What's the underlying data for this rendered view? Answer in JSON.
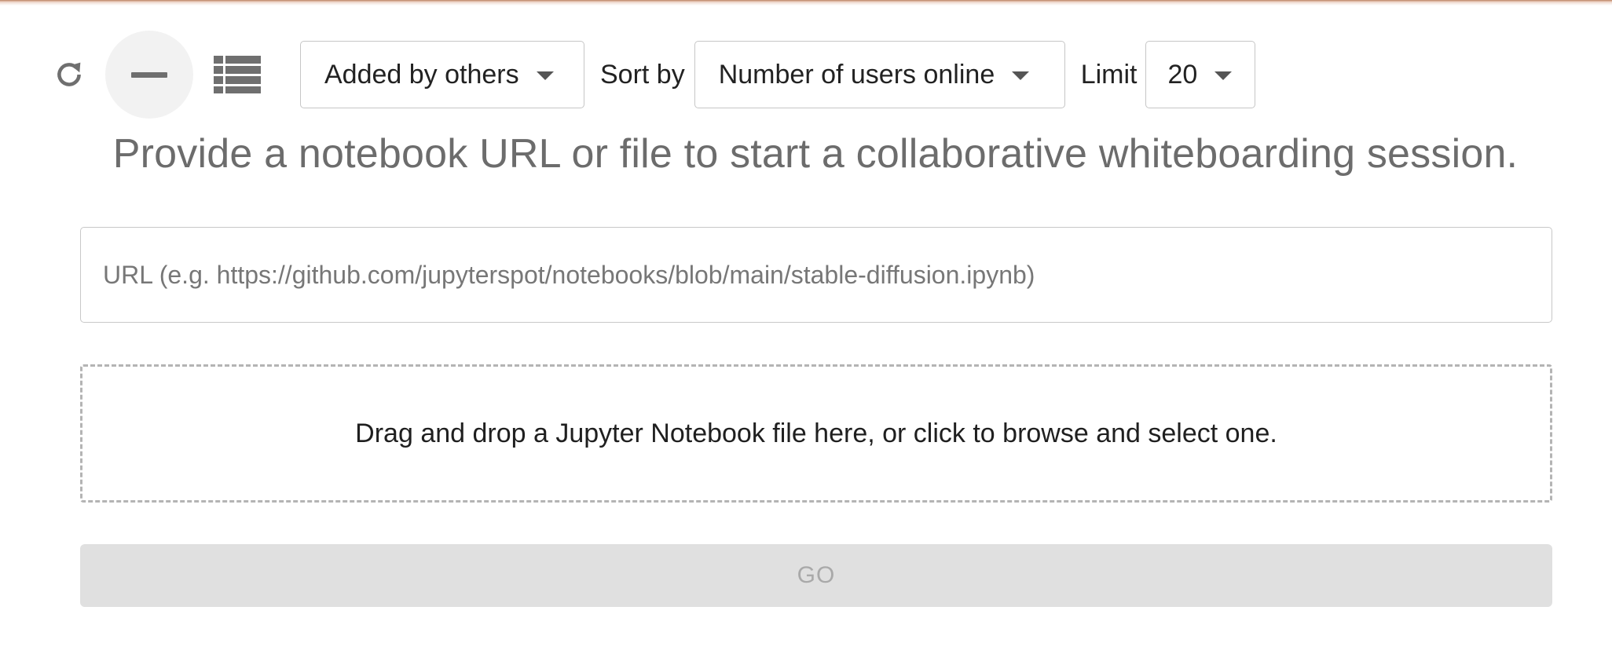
{
  "toolbar": {
    "refresh_icon": "refresh-icon",
    "collapse_icon": "minus-icon",
    "list_icon": "list-view-icon",
    "filter": {
      "selected": "Added by others"
    },
    "sort": {
      "label": "Sort by",
      "selected": "Number of users online"
    },
    "limit": {
      "label": "Limit",
      "selected": "20"
    }
  },
  "main": {
    "headline": "Provide a notebook URL or file to start a collaborative whiteboarding session.",
    "url_input": {
      "value": "",
      "placeholder": "URL (e.g. https://github.com/jupyterspot/notebooks/blob/main/stable-diffusion.ipynb)"
    },
    "dropzone_text": "Drag and drop a Jupyter Notebook file here, or click to browse and select one.",
    "go_label": "GO"
  },
  "colors": {
    "headline": "#6c6c6c",
    "go_background": "#e0e0e0",
    "go_text": "#a9a9a9",
    "icon": "#6f6f6f"
  }
}
